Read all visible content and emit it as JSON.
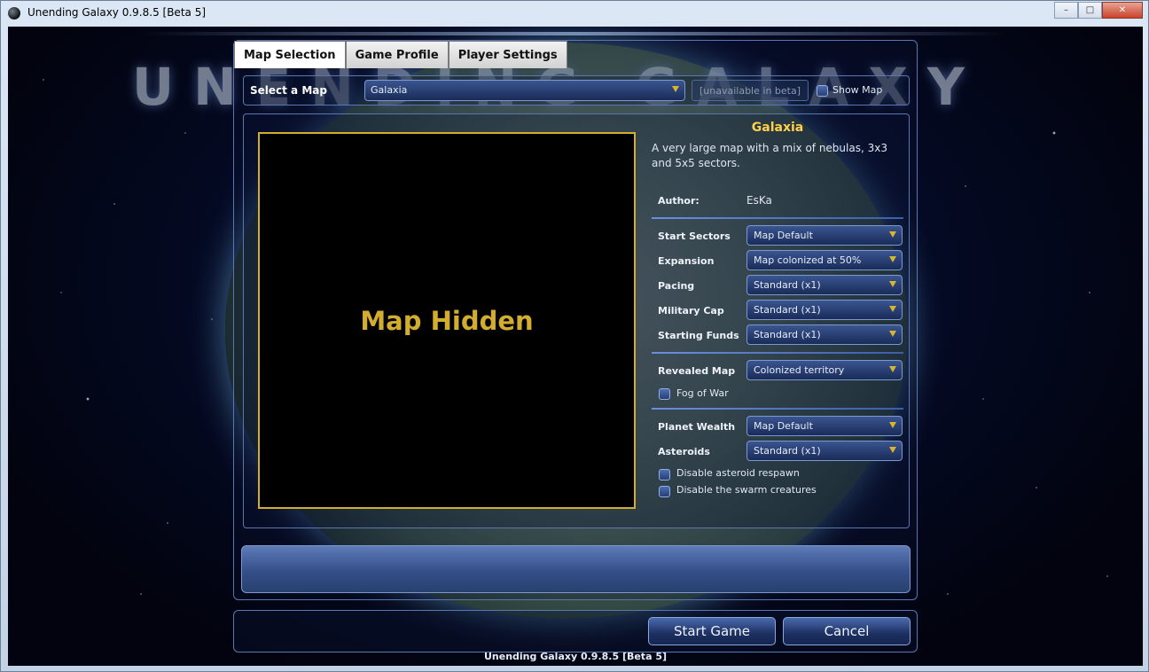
{
  "window": {
    "title": "Unending Galaxy 0.9.8.5 [Beta 5]",
    "minimize": "–",
    "maximize": "□",
    "close": "✕"
  },
  "logo": {
    "text": "UNENDING GALAXY"
  },
  "tabs": [
    {
      "label": "Map Selection",
      "active": true
    },
    {
      "label": "Game Profile",
      "active": false
    },
    {
      "label": "Player Settings",
      "active": false
    }
  ],
  "map_select": {
    "label": "Select a Map",
    "selected": "Galaxia",
    "beta_note": "[unavailable in beta]",
    "show_map_label": "Show Map"
  },
  "preview": {
    "text": "Map Hidden"
  },
  "info": {
    "name": "Galaxia",
    "description": "A very large map with a mix of nebulas, 3x3 and 5x5 sectors.",
    "author_label": "Author:",
    "author": "EsKa",
    "settings": [
      {
        "label": "Start Sectors",
        "value": "Map Default"
      },
      {
        "label": "Expansion",
        "value": "Map colonized at 50%"
      },
      {
        "label": "Pacing",
        "value": "Standard (x1)"
      },
      {
        "label": "Military Cap",
        "value": "Standard (x1)"
      },
      {
        "label": "Starting Funds",
        "value": "Standard (x1)"
      }
    ],
    "revealed_map": {
      "label": "Revealed Map",
      "value": "Colonized territory"
    },
    "fog_of_war": "Fog of War",
    "planet_wealth": {
      "label": "Planet Wealth",
      "value": "Map Default"
    },
    "asteroids": {
      "label": "Asteroids",
      "value": "Standard (x1)"
    },
    "disable_respawn": "Disable asteroid respawn",
    "disable_swarm": "Disable the swarm creatures"
  },
  "buttons": {
    "start": "Start Game",
    "cancel": "Cancel"
  },
  "footer": "Unending Galaxy 0.9.8.5 [Beta 5]",
  "colors": {
    "accent_gold": "#d3ad2e",
    "panel_border": "#5a76b3",
    "dropdown_bg": "#2a4070"
  }
}
